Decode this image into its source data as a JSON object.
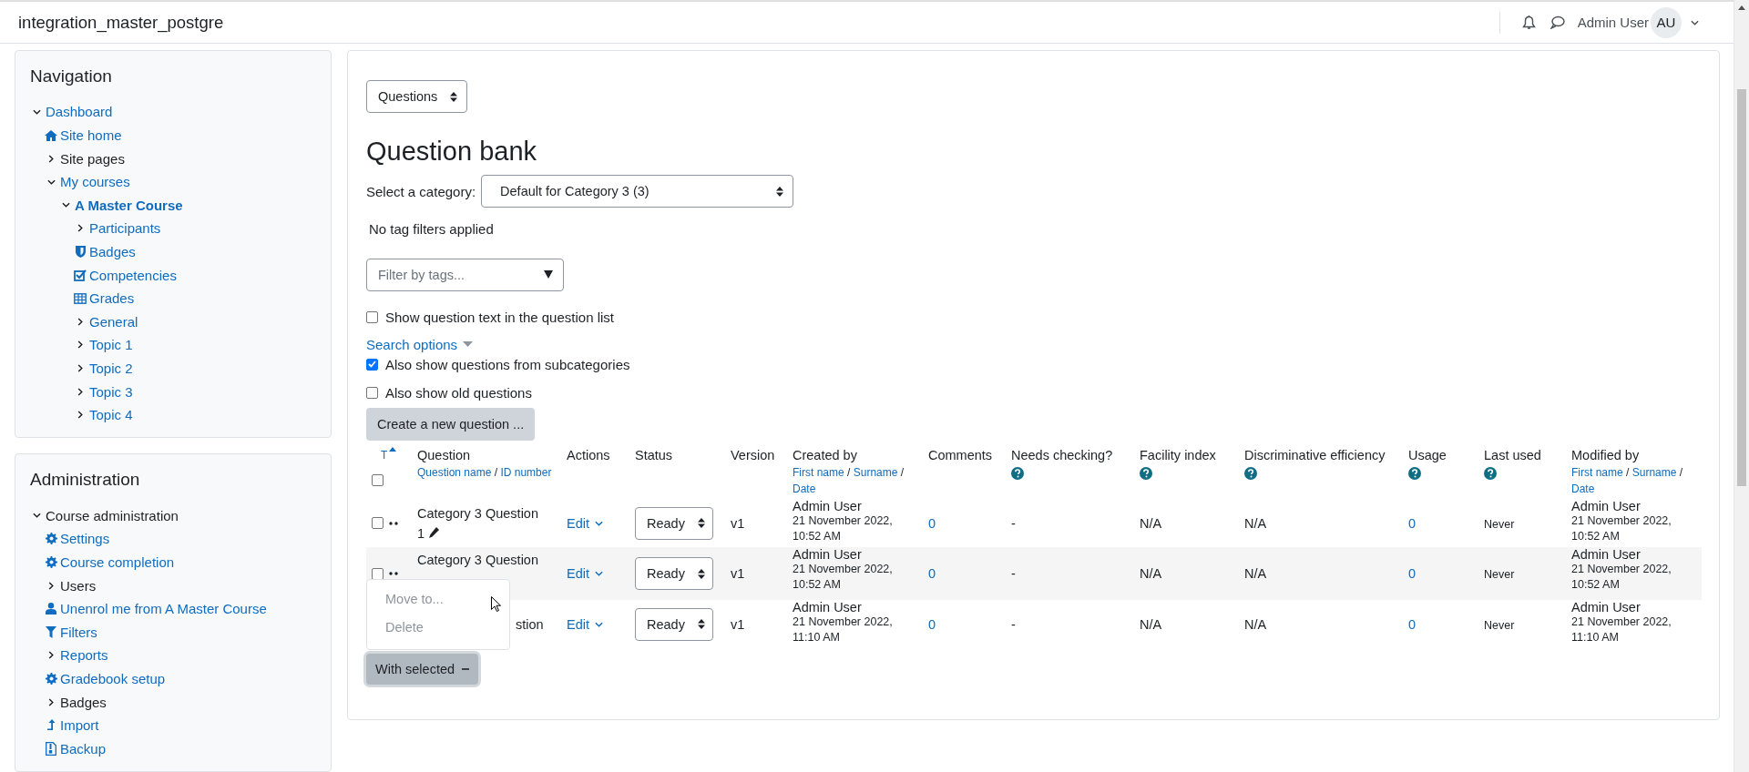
{
  "navbar": {
    "site_name": "integration_master_postgre",
    "user_name": "Admin User",
    "avatar_initials": "AU"
  },
  "navigation": {
    "title": "Navigation",
    "items": [
      {
        "kind": "branch",
        "label": "Dashboard",
        "link": true,
        "active": false,
        "expanded": true,
        "children": [
          {
            "kind": "home",
            "label": "Site home",
            "link": true,
            "active": false
          },
          {
            "kind": "branch",
            "label": "Site pages",
            "link": false,
            "active": false,
            "expanded": false
          },
          {
            "kind": "branch",
            "label": "My courses",
            "link": true,
            "active": false,
            "expanded": true,
            "children": [
              {
                "kind": "branch",
                "label": "A Master Course",
                "link": true,
                "active": true,
                "expanded": true,
                "children": [
                  {
                    "kind": "branch",
                    "label": "Participants",
                    "link": true,
                    "active": false,
                    "expanded": false
                  },
                  {
                    "kind": "shield",
                    "label": "Badges",
                    "link": true,
                    "active": false
                  },
                  {
                    "kind": "checklist",
                    "label": "Competencies",
                    "link": true,
                    "active": false
                  },
                  {
                    "kind": "grid",
                    "label": "Grades",
                    "link": true,
                    "active": false
                  },
                  {
                    "kind": "branch",
                    "label": "General",
                    "link": true,
                    "active": false,
                    "expanded": false
                  },
                  {
                    "kind": "branch",
                    "label": "Topic 1",
                    "link": true,
                    "active": false,
                    "expanded": false
                  },
                  {
                    "kind": "branch",
                    "label": "Topic 2",
                    "link": true,
                    "active": false,
                    "expanded": false
                  },
                  {
                    "kind": "branch",
                    "label": "Topic 3",
                    "link": true,
                    "active": false,
                    "expanded": false
                  },
                  {
                    "kind": "branch",
                    "label": "Topic 4",
                    "link": true,
                    "active": false,
                    "expanded": false
                  }
                ]
              }
            ]
          }
        ]
      }
    ]
  },
  "administration": {
    "title": "Administration",
    "items": [
      {
        "kind": "branch",
        "label": "Course administration",
        "link": false,
        "active": false,
        "expanded": true,
        "children": [
          {
            "kind": "gear",
            "label": "Settings",
            "link": true,
            "active": false
          },
          {
            "kind": "gear",
            "label": "Course completion",
            "link": true,
            "active": false
          },
          {
            "kind": "branch",
            "label": "Users",
            "link": false,
            "active": false,
            "expanded": false
          },
          {
            "kind": "person",
            "label": "Unenrol me from A Master Course",
            "link": true,
            "active": false
          },
          {
            "kind": "funnel",
            "label": "Filters",
            "link": true,
            "active": false
          },
          {
            "kind": "branch",
            "label": "Reports",
            "link": true,
            "active": false,
            "expanded": false
          },
          {
            "kind": "gear",
            "label": "Gradebook setup",
            "link": true,
            "active": false
          },
          {
            "kind": "branch",
            "label": "Badges",
            "link": false,
            "active": false,
            "expanded": false
          },
          {
            "kind": "upload",
            "label": "Import",
            "link": true,
            "active": false
          },
          {
            "kind": "archive",
            "label": "Backup",
            "link": true,
            "active": false
          }
        ]
      }
    ]
  },
  "question_bank": {
    "page_select": "Questions",
    "title": "Question bank",
    "category_label": "Select a category:",
    "category_value": "Default for Category 3 (3)",
    "tag_status": "No tag filters applied",
    "tag_filter": {
      "placeholder": "Filter by tags..."
    },
    "options": [
      {
        "label": "Show question text in the question list",
        "checked": false
      }
    ],
    "search_options": "Search options",
    "search_checks": [
      {
        "label": "Also show questions from subcategories",
        "checked": true
      },
      {
        "label": "Also show old questions",
        "checked": false
      }
    ],
    "create_button": "Create a new question ...",
    "table": {
      "columns": [
        {
          "kind": "select",
          "label": "T",
          "checked": false
        },
        {
          "kind": "links",
          "label": "Question",
          "links": [
            "Question name",
            "ID number"
          ],
          "separator": "/"
        },
        {
          "kind": "plain",
          "label": "Actions"
        },
        {
          "kind": "plain",
          "label": "Status"
        },
        {
          "kind": "plain",
          "label": "Version"
        },
        {
          "kind": "links",
          "label": "Created by",
          "links": [
            "First name",
            "Surname",
            "Date"
          ],
          "separator": "/"
        },
        {
          "kind": "plain",
          "label": "Comments"
        },
        {
          "kind": "help",
          "label": "Needs checking?"
        },
        {
          "kind": "help",
          "label": "Facility index"
        },
        {
          "kind": "help",
          "label": "Discriminative efficiency"
        },
        {
          "kind": "help",
          "label": "Usage"
        },
        {
          "kind": "help",
          "label": "Last used"
        },
        {
          "kind": "links",
          "label": "Modified by",
          "links": [
            "First name",
            "Surname",
            "Date"
          ],
          "separator": "/"
        }
      ],
      "rows": [
        {
          "checked": false,
          "name": "Category 3 Question 1",
          "editable": true,
          "action": "Edit",
          "status": "Ready",
          "version": "v1",
          "created_by": "Admin User",
          "created_date": "21 November 2022, 10:52 AM",
          "comments": "0",
          "needs_checking": "-",
          "facility_index": "N/A",
          "discriminative_efficiency": "N/A",
          "usage": "0",
          "last_used": "Never",
          "modified_by": "Admin User",
          "modified_date": "21 November 2022, 10:52 AM"
        },
        {
          "checked": false,
          "name": "Category 3 Question",
          "editable": false,
          "action": "Edit",
          "status": "Ready",
          "version": "v1",
          "created_by": "Admin User",
          "created_date": "21 November 2022, 10:52 AM",
          "comments": "0",
          "needs_checking": "-",
          "facility_index": "N/A",
          "discriminative_efficiency": "N/A",
          "usage": "0",
          "last_used": "Never",
          "modified_by": "Admin User",
          "modified_date": "21 November 2022, 10:52 AM"
        },
        {
          "name": "stion",
          "editable": false,
          "action": "Edit",
          "status": "Ready",
          "version": "v1",
          "created_by": "Admin User",
          "created_date": "21 November 2022, 11:10 AM",
          "comments": "0",
          "needs_checking": "-",
          "facility_index": "N/A",
          "discriminative_efficiency": "N/A",
          "usage": "0",
          "last_used": "Never",
          "modified_by": "Admin User",
          "modified_date": "21 November 2022, 11:10 AM"
        }
      ]
    },
    "with_selected": {
      "label": "With selected",
      "expanded": true,
      "menu": [
        {
          "label": "Move to...",
          "disabled": true
        },
        {
          "label": "Delete",
          "disabled": true
        }
      ]
    }
  }
}
